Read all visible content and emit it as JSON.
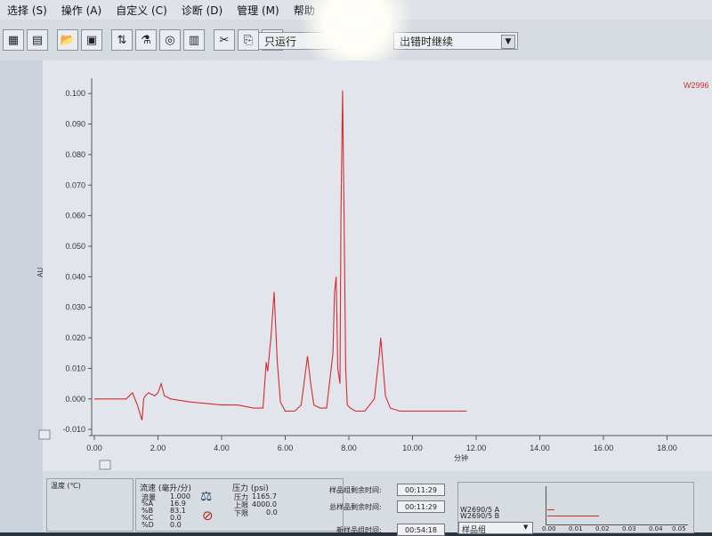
{
  "menu": {
    "items": [
      "选择 (S)",
      "操作 (A)",
      "自定义 (C)",
      "诊断 (D)",
      "管理 (M)",
      "帮助"
    ]
  },
  "toolbar": {
    "mode_combo": "只运行",
    "error_combo": "出错时继续"
  },
  "chart": {
    "watermark": "W2996",
    "ylabel": "AU",
    "xlabel": "分钟",
    "y_ticks": [
      "0.100",
      "0.090",
      "0.080",
      "0.070",
      "0.060",
      "0.050",
      "0.040",
      "0.030",
      "0.020",
      "0.010",
      "0.000",
      "-0.010"
    ],
    "x_ticks": [
      "0.00",
      "2.00",
      "4.00",
      "6.00",
      "8.00",
      "10.00",
      "12.00",
      "14.00",
      "16.00",
      "18.00"
    ]
  },
  "chart_data": {
    "type": "line",
    "title": "",
    "xlabel": "分钟",
    "ylabel": "AU",
    "xlim": [
      0,
      19.3
    ],
    "ylim": [
      -0.012,
      0.105
    ],
    "grid": false,
    "series": [
      {
        "name": "W2996",
        "color": "#d42c2c",
        "x": [
          0.0,
          0.5,
          1.0,
          1.2,
          1.35,
          1.5,
          1.55,
          1.6,
          1.7,
          1.9,
          2.0,
          2.1,
          2.15,
          2.2,
          2.4,
          3.0,
          4.0,
          4.5,
          5.0,
          5.3,
          5.4,
          5.45,
          5.55,
          5.65,
          5.75,
          5.85,
          6.0,
          6.3,
          6.5,
          6.6,
          6.7,
          6.8,
          6.9,
          7.1,
          7.3,
          7.5,
          7.55,
          7.6,
          7.65,
          7.72,
          7.75,
          7.8,
          7.85,
          7.9,
          7.95,
          8.05,
          8.2,
          8.5,
          8.8,
          8.95,
          9.0,
          9.05,
          9.15,
          9.3,
          9.6,
          10.0,
          11.0,
          11.7
        ],
        "y": [
          0.0,
          0.0,
          0.0,
          0.002,
          -0.002,
          -0.007,
          0.0,
          0.001,
          0.002,
          0.001,
          0.002,
          0.005,
          0.003,
          0.001,
          0.0,
          -0.001,
          -0.002,
          -0.002,
          -0.003,
          -0.003,
          0.012,
          0.009,
          0.02,
          0.035,
          0.012,
          -0.001,
          -0.004,
          -0.004,
          -0.002,
          0.006,
          0.014,
          0.005,
          -0.002,
          -0.003,
          -0.003,
          0.015,
          0.035,
          0.04,
          0.01,
          0.005,
          0.06,
          0.101,
          0.06,
          0.01,
          -0.002,
          -0.003,
          -0.004,
          -0.004,
          0.0,
          0.014,
          0.02,
          0.014,
          0.001,
          -0.003,
          -0.004,
          -0.004,
          -0.004,
          -0.004
        ]
      }
    ]
  },
  "bottom": {
    "temp_label": "温度 (℃)",
    "flow_title": "流速 (毫升/分)",
    "flow_rows": [
      {
        "name": "流量",
        "value": "1.000"
      },
      {
        "name": "%A",
        "value": "16.9"
      },
      {
        "name": "%B",
        "value": "83.1"
      },
      {
        "name": "%C",
        "value": "0.0"
      },
      {
        "name": "%D",
        "value": "0.0"
      }
    ],
    "pressure_title": "压力 (psi)",
    "pressure_rows": [
      {
        "name": "压力",
        "value": "1165.7"
      },
      {
        "name": "上限",
        "value": "4000.0"
      },
      {
        "name": "下限",
        "value": "0.0"
      }
    ],
    "time_rows": [
      {
        "name": "样品组剩余时间:",
        "value": "00:11:29"
      },
      {
        "name": "总样品剩余时间:",
        "value": "00:11:29"
      },
      {
        "name": "新样品组时间:",
        "value": "00:54:18"
      }
    ],
    "mini_legend": [
      "W2690/5 A",
      "W2690/5 B"
    ],
    "mini_x_ticks": [
      "0.00",
      "0.01",
      "0.02",
      "0.03",
      "0.04",
      "0.05"
    ],
    "sample_set_label": "样品组"
  }
}
